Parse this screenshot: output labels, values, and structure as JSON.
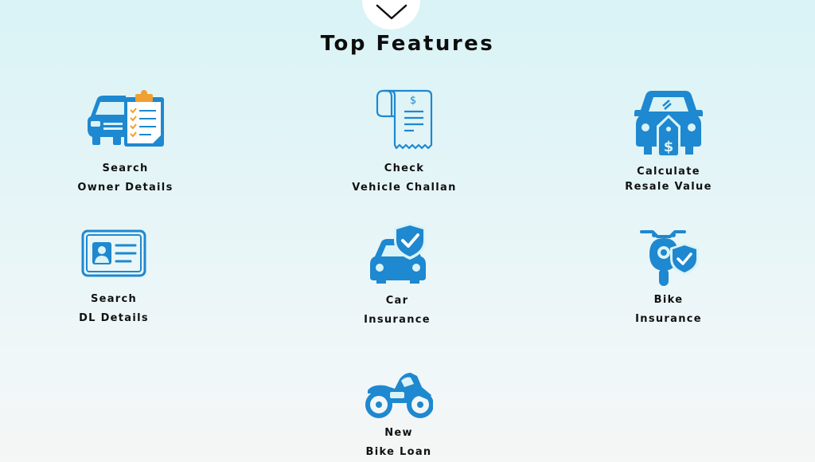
{
  "section": {
    "title": "Top Features"
  },
  "icons": {
    "scroll": "chevron-down-icon"
  },
  "colors": {
    "accent": "#1e88d0",
    "text": "#111111"
  },
  "features": [
    {
      "line1": "Search",
      "line2": "Owner Details",
      "icon": "car-clipboard-icon"
    },
    {
      "line1": "Check",
      "line2": "Vehicle Challan",
      "icon": "receipt-icon"
    },
    {
      "line1": "Calculate",
      "line2": "Resale Value",
      "icon": "car-price-tag-icon"
    },
    {
      "line1": "Search",
      "line2": "DL Details",
      "icon": "id-card-icon"
    },
    {
      "line1": "Car",
      "line2": "Insurance",
      "icon": "car-shield-icon"
    },
    {
      "line1": "Bike",
      "line2": "Insurance",
      "icon": "bike-shield-icon"
    },
    {
      "line1": "New",
      "line2": "Bike Loan",
      "icon": "motorcycle-icon"
    }
  ]
}
